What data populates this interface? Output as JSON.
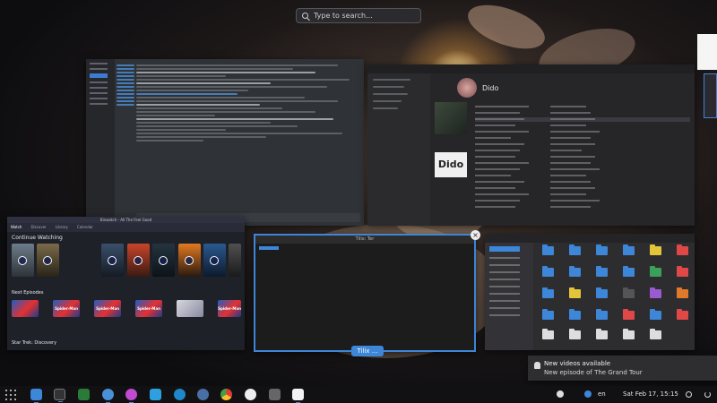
{
  "search": {
    "placeholder": "Type to search..."
  },
  "media_window": {
    "title": "Binwatch - All The Feel Good",
    "tabs": [
      "Watch",
      "Discover",
      "Library",
      "Calendar"
    ],
    "continue_watching_label": "Continue Watching",
    "next_episodes_label": "Next Episodes",
    "star_trek_label": "Star Trek: Discovery",
    "episode_titles": [
      "Spider-Man",
      "Spider-Man",
      "Spider-Man",
      "Spider-Man"
    ]
  },
  "music_window": {
    "artist": "Dido",
    "album_cover_text": "Dido"
  },
  "terminal_window": {
    "title": "Tilix: Ter"
  },
  "tile_label": "Tilix ...",
  "notification": {
    "title": "New videos available",
    "body": "New episode of The Grand Tour"
  },
  "taskbar": {
    "keyboard_layout": "en",
    "clock": "Sat Feb 17, 15:15"
  },
  "colors": {
    "accent": "#3d86d8",
    "taskbar": "#111113",
    "notification_bg": "#2e2e30"
  },
  "icons": {
    "apps_grid": "app-grid-icon",
    "notification": "bell-icon",
    "close": "close-icon"
  }
}
